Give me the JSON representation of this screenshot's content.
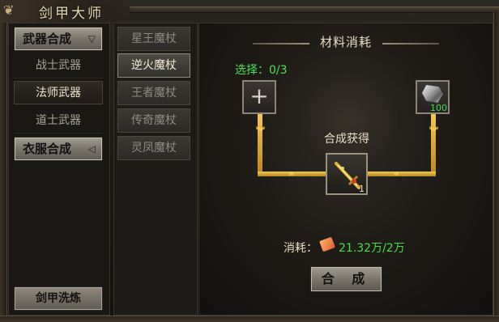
{
  "window": {
    "title": "剑甲大师"
  },
  "nav": {
    "weapon_category": "武器合成",
    "weapon_items": [
      "战士武器",
      "法师武器",
      "道士武器"
    ],
    "active_weapon_index": 1,
    "clothes_category": "衣服合成",
    "refine_button": "剑甲洗炼"
  },
  "wands": {
    "items": [
      "星王魔杖",
      "逆火魔杖",
      "王者魔杖",
      "传奇魔杖",
      "灵凤魔杖"
    ],
    "active_index": 1
  },
  "craft": {
    "header": "材料消耗",
    "select_text": "选择：0/3",
    "material_count": "100",
    "result_label": "合成获得",
    "result_count": "1",
    "cost_label": "消耗：",
    "cost_value": "21.32万/2万",
    "craft_button": "合 成"
  },
  "colors": {
    "green_text": "#3fe046",
    "gold_pipe": "#e0b040",
    "button_grey": "#8e887d"
  },
  "icons": {
    "title": "dragon-emblem-icon",
    "add_slot": "plus-icon",
    "material": "silver-ore-icon",
    "result": "golden-sword-icon",
    "cost": "gold-ingot-icon",
    "category_expanded": "chevron-down-icon",
    "category_collapsed": "chevron-left-icon"
  }
}
